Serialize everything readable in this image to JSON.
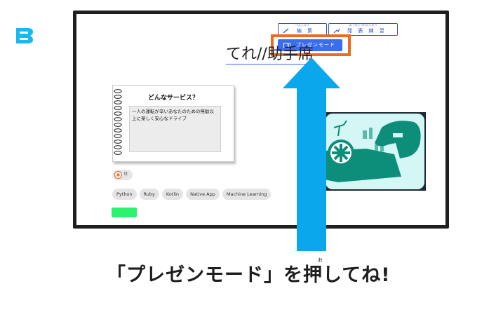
{
  "logo": {
    "glyph": "B",
    "color": "#17b9f0"
  },
  "toolbar": {
    "edit_ruby": "へんしゅう",
    "edit_label": "編 集",
    "practice_ruby": "はっぴょうれんしゅう",
    "practice_label": "発 表 練 習",
    "present_label": "プレゼンモード"
  },
  "document": {
    "title": "てれ//助手席"
  },
  "service_card": {
    "title": "どんなサービス？",
    "body": "一人の運転が辛いあなたのための無駄以上に楽しく安心なドライブ"
  },
  "author": {
    "handle": "tt"
  },
  "tags": [
    "Python",
    "Ruby",
    "Kotlin",
    "Native App",
    "Machine Learning"
  ],
  "caption": {
    "text": "「プレゼンモード」を押してね!",
    "ruby": "お"
  },
  "colors": {
    "accent": "#3b6df0",
    "highlight": "#ef6a1f",
    "arrow": "#0aa7ec",
    "green": "#2bf36e"
  }
}
